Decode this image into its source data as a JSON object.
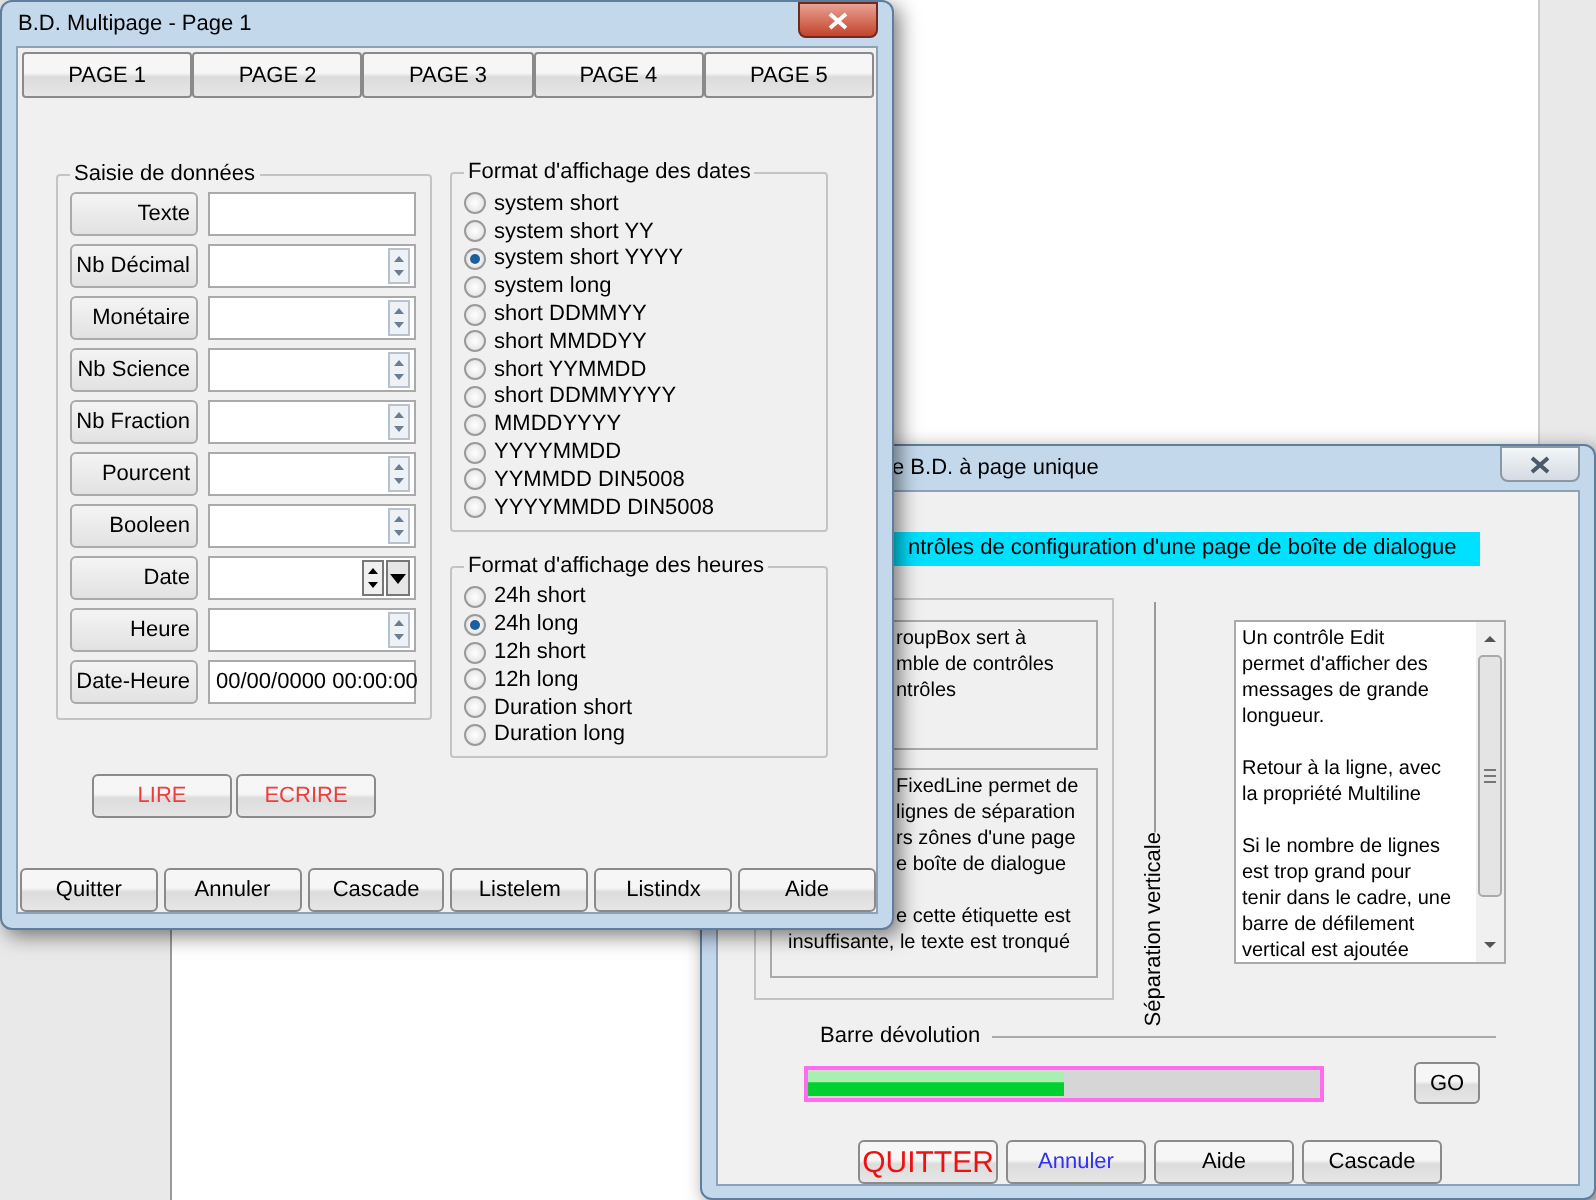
{
  "main_window": {
    "title": "B.D. Multipage - Page 1",
    "page_buttons": [
      "PAGE 1",
      "PAGE 2",
      "PAGE 3",
      "PAGE 4",
      "PAGE 5"
    ],
    "data_group": {
      "title": "Saisie de données",
      "fields": [
        {
          "label": "Texte",
          "kind": "text"
        },
        {
          "label": "Nb Décimal",
          "kind": "spin"
        },
        {
          "label": "Monétaire",
          "kind": "spin"
        },
        {
          "label": "Nb Science",
          "kind": "spin"
        },
        {
          "label": "Nb Fraction",
          "kind": "spin"
        },
        {
          "label": "Pourcent",
          "kind": "spin"
        },
        {
          "label": "Booleen",
          "kind": "spin"
        },
        {
          "label": "Date",
          "kind": "date"
        },
        {
          "label": "Heure",
          "kind": "spin"
        },
        {
          "label": "Date-Heure",
          "kind": "text",
          "value": "00/00/0000 00:00:00"
        }
      ]
    },
    "date_group": {
      "title": "Format d'affichage des dates",
      "options": [
        {
          "label": "system short",
          "selected": false
        },
        {
          "label": "system short YY",
          "selected": false
        },
        {
          "label": "system short YYYY",
          "selected": true
        },
        {
          "label": "system long",
          "selected": false
        },
        {
          "label": "short DDMMYY",
          "selected": false
        },
        {
          "label": "short MMDDYY",
          "selected": false
        },
        {
          "label": "short YYMMDD",
          "selected": false
        },
        {
          "label": "short DDMMYYYY",
          "selected": false
        },
        {
          "label": "MMDDYYYY",
          "selected": false
        },
        {
          "label": "YYYYMMDD",
          "selected": false
        },
        {
          "label": "YYMMDD DIN5008",
          "selected": false
        },
        {
          "label": "YYYYMMDD DIN5008",
          "selected": false
        }
      ]
    },
    "time_group": {
      "title": "Format d'affichage des heures",
      "options": [
        {
          "label": "24h short",
          "selected": false
        },
        {
          "label": "24h long",
          "selected": true
        },
        {
          "label": "12h short",
          "selected": false
        },
        {
          "label": "12h long",
          "selected": false
        },
        {
          "label": "Duration short",
          "selected": false
        },
        {
          "label": "Duration long",
          "selected": false
        }
      ]
    },
    "action_buttons": [
      "LIRE",
      "ECRIRE"
    ],
    "bottom_buttons": [
      "Quitter",
      "Annuler",
      "Cascade",
      "Listelem",
      "Listindx",
      "Aide"
    ]
  },
  "second_window": {
    "title": "e B.D. à page unique",
    "banner": "ntrôles de configuration d'une page de boîte de dialogue",
    "groupbox_note": [
      "roupBox sert à",
      "mble de contrôles",
      "ntrôles"
    ],
    "fixedline_note": [
      [
        "FixedLine permet de",
        "lignes de séparation",
        "rs zônes d'une page",
        "e boîte de dialogue"
      ],
      [
        "e cette étiquette est",
        "insuffisante, le texte est tronqué"
      ]
    ],
    "separator_label": "Séparation verticale",
    "multiline": [
      [
        "Un contrôle Edit",
        "permet d'afficher des",
        "messages de grande",
        "longueur."
      ],
      [
        "Retour à la ligne, avec",
        "la propriété Multiline"
      ],
      [
        "Si le nombre de lignes",
        "est trop grand pour",
        "tenir dans le cadre, une",
        "barre de défilement",
        "vertical est ajoutée"
      ]
    ],
    "progress": {
      "label": "Barre dévolution",
      "level": 0.5
    },
    "go_button": "GO",
    "buttons": [
      {
        "label": "QUITTER",
        "kind": "danger"
      },
      {
        "label": "Annuler",
        "kind": "accent"
      },
      {
        "label": "Aide",
        "kind": "plain"
      },
      {
        "label": "Cascade",
        "kind": "plain"
      }
    ]
  }
}
